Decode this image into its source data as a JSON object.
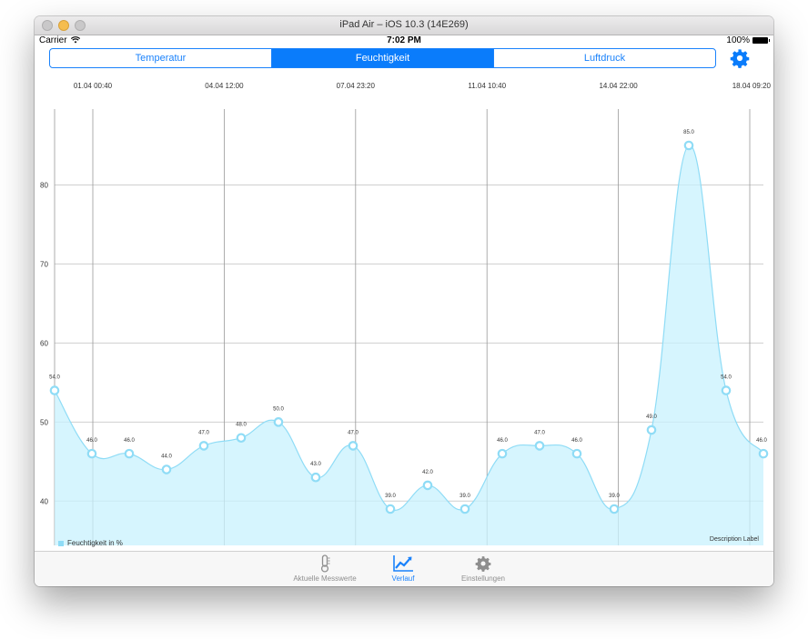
{
  "window": {
    "title": "iPad Air – iOS 10.3 (14E269)"
  },
  "status": {
    "carrier": "Carrier",
    "time": "7:02 PM",
    "battery": "100%"
  },
  "segments": [
    {
      "label": "Temperatur",
      "active": false
    },
    {
      "label": "Feuchtigkeit",
      "active": true
    },
    {
      "label": "Luftdruck",
      "active": false
    }
  ],
  "settings_icon": "gear-icon",
  "colors": {
    "accent": "#0a7cfb",
    "fill": "#c8f1fd",
    "line": "#8fdcf6"
  },
  "chart_data": {
    "type": "area",
    "x_tick_labels": [
      "01.04 00:40",
      "04.04 12:00",
      "07.04 23:20",
      "11.04 10:40",
      "14.04 22:00",
      "18.04 09:20"
    ],
    "y_ticks": [
      40,
      50,
      60,
      70,
      80
    ],
    "ylim": [
      34.4,
      89.6
    ],
    "grid": true,
    "series": [
      {
        "name": "Feuchtigkeit in %",
        "values": [
          54,
          46,
          46,
          44,
          47,
          48,
          50,
          43,
          47,
          39,
          42,
          39,
          46,
          47,
          46,
          39,
          49,
          85,
          54,
          46
        ],
        "value_labels": [
          "54.0",
          "46.0",
          "46.0",
          "44.0",
          "47.0",
          "48.0",
          "50.0",
          "43.0",
          "47.0",
          "39.0",
          "42.0",
          "39.0",
          "46.0",
          "47.0",
          "46.0",
          "39.0",
          "49.0",
          "85.0",
          "54.0",
          "46.0"
        ]
      }
    ],
    "description": "Description Label",
    "legend": "bottom-left"
  },
  "tabs": [
    {
      "label": "Aktuelle Messwerte",
      "icon": "thermometer-icon",
      "active": false
    },
    {
      "label": "Verlauf",
      "icon": "chart-icon",
      "active": true
    },
    {
      "label": "Einstellungen",
      "icon": "gear-icon",
      "active": false
    }
  ]
}
